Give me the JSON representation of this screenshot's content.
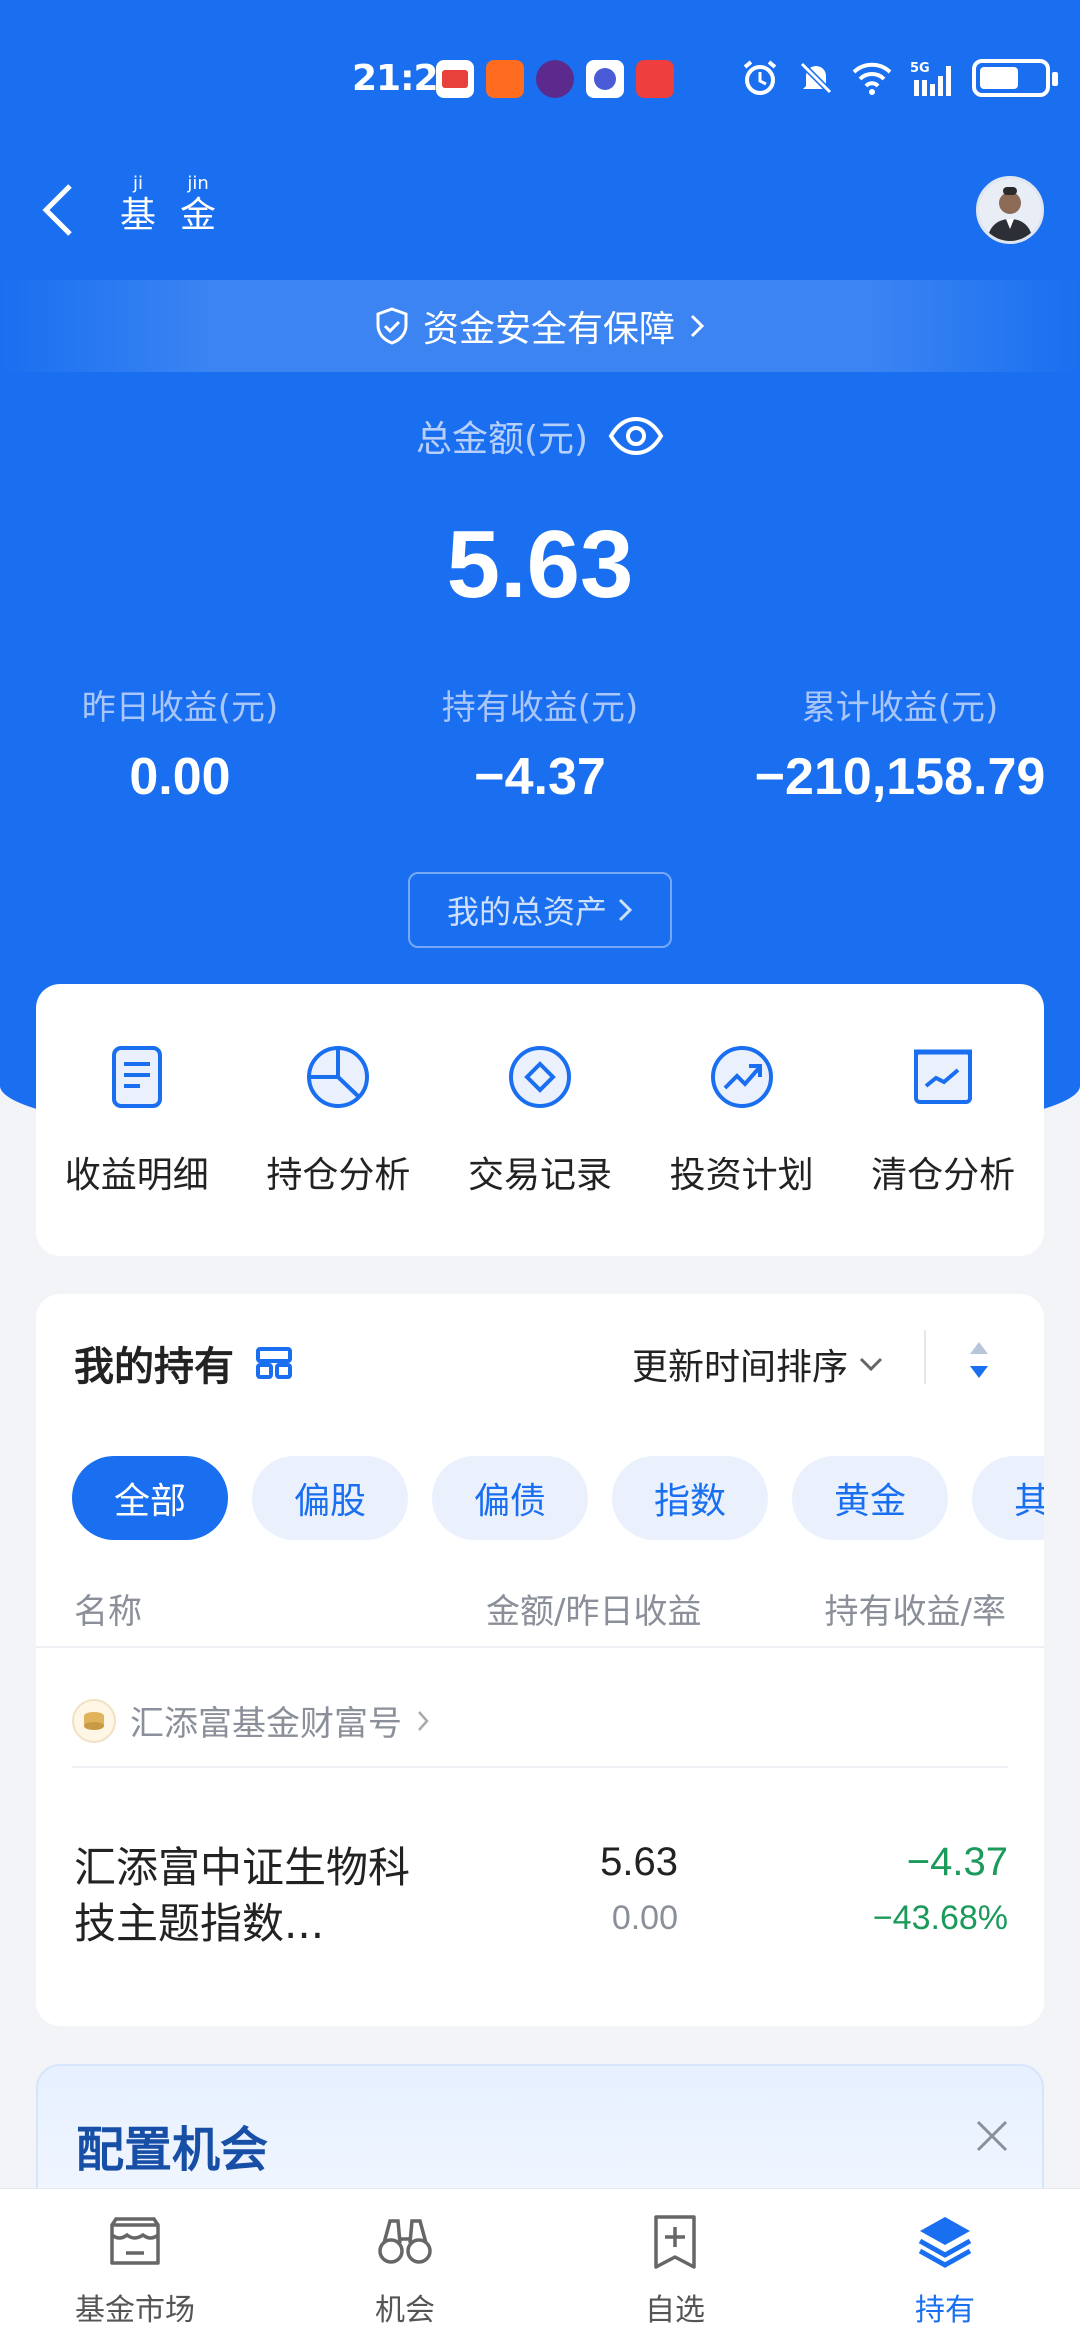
{
  "status_bar": {
    "time": "21:25"
  },
  "header": {
    "title_chars": [
      {
        "pinyin": "ji",
        "hanzi": "基"
      },
      {
        "pinyin": "jin",
        "hanzi": "金"
      }
    ]
  },
  "safety_banner": "资金安全有保障",
  "summary": {
    "total_label": "总金额(元)",
    "total_value": "5.63",
    "metrics": [
      {
        "label": "昨日收益(元)",
        "value": "0.00"
      },
      {
        "label": "持有收益(元)",
        "value": "−4.37"
      },
      {
        "label": "累计收益(元)",
        "value": "−210,158.79"
      }
    ],
    "assets_button": "我的总资产"
  },
  "tools": [
    {
      "label": "收益明细",
      "icon": "document-icon"
    },
    {
      "label": "持仓分析",
      "icon": "pie-chart-icon"
    },
    {
      "label": "交易记录",
      "icon": "diamond-circle-icon"
    },
    {
      "label": "投资计划",
      "icon": "trend-up-icon"
    },
    {
      "label": "清仓分析",
      "icon": "line-chart-icon"
    }
  ],
  "holdings": {
    "title": "我的持有",
    "sort_label": "更新时间排序",
    "chips": [
      "全部",
      "偏股",
      "偏债",
      "指数",
      "黄金",
      "其他"
    ],
    "columns": {
      "name": "名称",
      "amount": "金额/昨日收益",
      "gain": "持有收益/率"
    },
    "company": "汇添富基金财富号",
    "fund": {
      "name": "汇添富中证生物科技主题指数...",
      "amount": "5.63",
      "yesterday": "0.00",
      "gain": "−4.37",
      "rate": "−43.68%"
    }
  },
  "opportunity": {
    "title": "配置机会"
  },
  "tabbar": [
    {
      "label": "基金市场",
      "icon": "market-icon"
    },
    {
      "label": "机会",
      "icon": "binoculars-icon"
    },
    {
      "label": "自选",
      "icon": "add-bookmark-icon"
    },
    {
      "label": "持有",
      "icon": "layers-icon"
    }
  ],
  "colors": {
    "primary": "#1a6ff0",
    "gain_negative": "#1c9a5b"
  }
}
